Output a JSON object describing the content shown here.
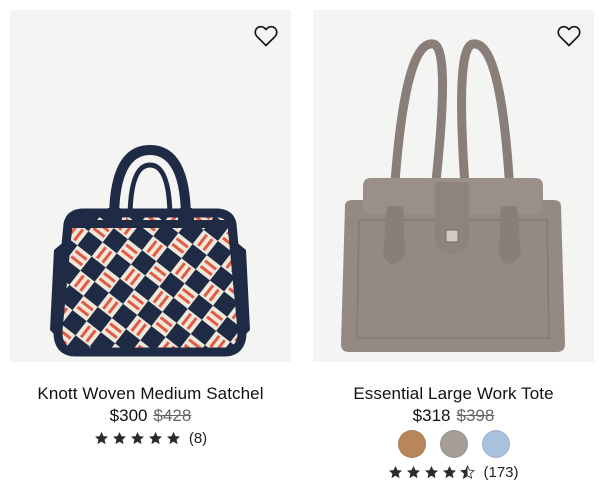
{
  "products": [
    {
      "name": "Knott Woven Medium Satchel",
      "sale_price": "$300",
      "original_price": "$428",
      "rating": 5,
      "review_count": "(8)",
      "favorite_icon": "heart-outline-icon"
    },
    {
      "name": "Essential Large Work Tote",
      "sale_price": "$318",
      "original_price": "$398",
      "rating": 4.5,
      "review_count": "(173)",
      "favorite_icon": "heart-outline-icon",
      "swatches": [
        {
          "color": "#b8865a"
        },
        {
          "color": "#a59e98"
        },
        {
          "color": "#a9c1dc"
        }
      ]
    }
  ],
  "colors": {
    "background": "#ffffff",
    "image_bg": "#f4f4f3",
    "star": "#2b2b2b",
    "navy": "#1f2a44",
    "coral": "#e25a45",
    "cream": "#efe9dc",
    "taupe": "#958a83"
  }
}
